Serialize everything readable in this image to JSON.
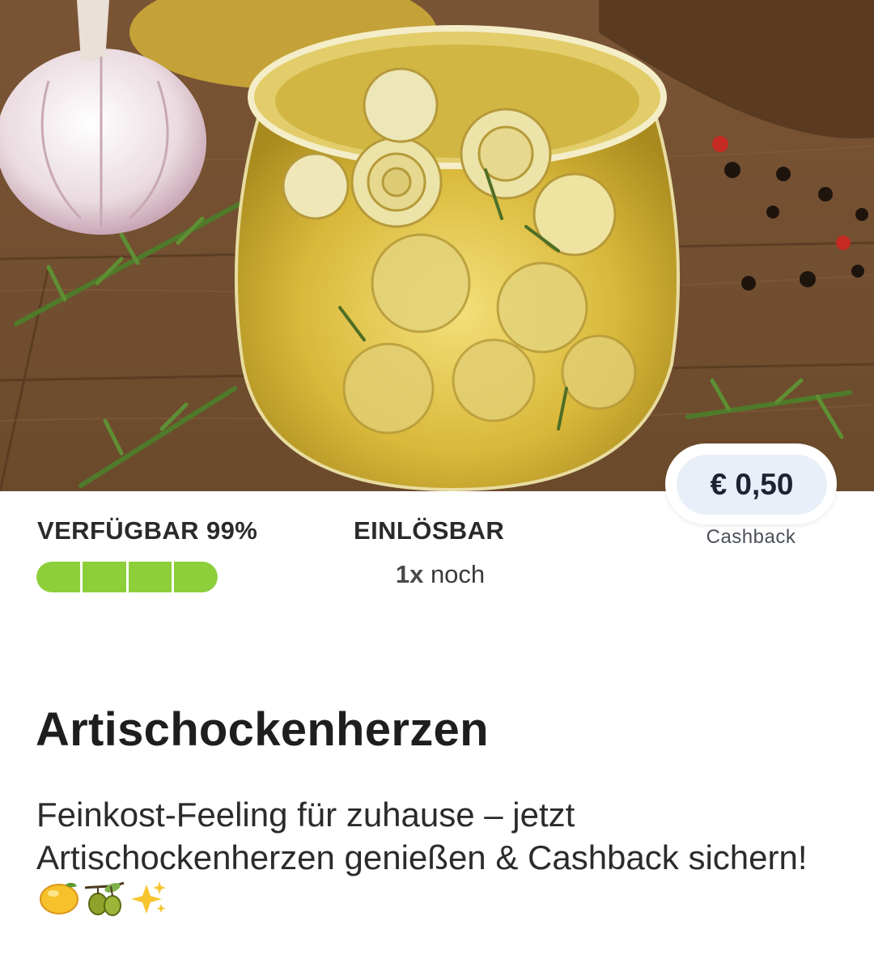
{
  "offer": {
    "image_alt": "Artischockenherzen im Glas",
    "cashback": {
      "amount": "€ 0,50",
      "label": "Cashback"
    },
    "availability": {
      "label": "VERFÜGBAR",
      "percent_text": "99%",
      "percent": 0.99
    },
    "redeemable": {
      "label": "EINLÖSBAR",
      "count": "1x",
      "suffix": "noch"
    },
    "title": "Artischockenherzen",
    "description": "Feinkost-Feeling für zuhause – jetzt Artischockenherzen genießen & Cashback sichern!",
    "emojis": [
      "lemon-icon",
      "olive-branch-icon",
      "sparkles-icon"
    ],
    "colors": {
      "progress": "#8ccf3a",
      "pill_bg": "#e9eff9"
    }
  }
}
